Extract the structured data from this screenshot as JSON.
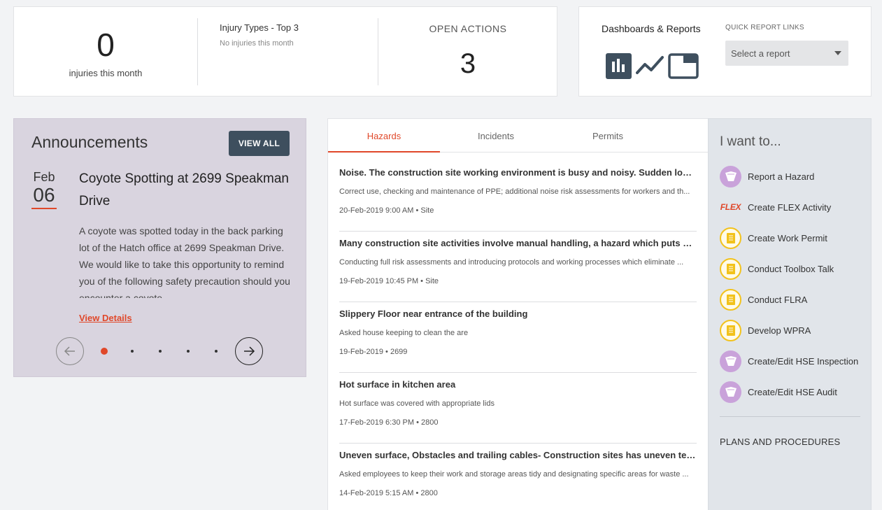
{
  "stats": {
    "injuries_count": "0",
    "injuries_caption": "injuries this month",
    "injury_types_title": "Injury Types - Top 3",
    "injury_types_empty": "No injuries this month",
    "open_actions_title": "OPEN ACTIONS",
    "open_actions_count": "3"
  },
  "dashboards": {
    "title": "Dashboards & Reports",
    "icons": [
      "bar-chart-icon",
      "line-chart-icon",
      "window-icon"
    ],
    "quick_links_label": "QUICK REPORT LINKS",
    "select_placeholder": "Select a report"
  },
  "announcements": {
    "title": "Announcements",
    "view_all_label": "VIEW ALL",
    "month": "Feb",
    "day": "06",
    "headline": "Coyote Spotting at 2699 Speakman Drive",
    "body": "A coyote was spotted today in the back parking lot of the Hatch office at 2699 Speakman Drive. We would like to take this opportunity to remind you of the following safety precaution should you encounter a coyote.",
    "view_details_label": "View Details",
    "total_slides": 5,
    "active_slide": 1
  },
  "feed": {
    "tabs": [
      "Hazards",
      "Incidents",
      "Permits"
    ],
    "active_tab": "Hazards",
    "items": [
      {
        "title": "Noise. The construction site working environment is busy and noisy. Sudden loud v...",
        "desc": "Correct use, checking and maintenance of PPE; additional noise risk assessments for workers and th...",
        "meta": "20-Feb-2019 9:00 AM • Site"
      },
      {
        "title": "Many construction site activities involve manual handling, a hazard which puts wor...",
        "desc": "Conducting full risk assessments and introducing protocols and working processes which eliminate ...",
        "meta": "19-Feb-2019 10:45 PM • Site"
      },
      {
        "title": "Slippery Floor near entrance of the building",
        "desc": "Asked house keeping to clean the are",
        "meta": "19-Feb-2019 • 2699"
      },
      {
        "title": "Hot surface in kitchen area",
        "desc": "Hot surface was covered with appropriate lids",
        "meta": "17-Feb-2019 6:30 PM • 2800"
      },
      {
        "title": "Uneven surface, Obstacles and trailing cables- Construction sites has uneven terrai...",
        "desc": "Asked employees to keep their work and storage areas tidy and designating specific areas for waste ...",
        "meta": "14-Feb-2019 5:15 AM • 2800"
      }
    ]
  },
  "want": {
    "title": "I want to...",
    "items": [
      {
        "label": "Report a Hazard",
        "icon": "hazard-icon"
      },
      {
        "label": "Create FLEX Activity",
        "icon": "flex-logo"
      },
      {
        "label": "Create Work Permit",
        "icon": "document-icon"
      },
      {
        "label": "Conduct Toolbox Talk",
        "icon": "document-icon"
      },
      {
        "label": "Conduct FLRA",
        "icon": "document-icon"
      },
      {
        "label": "Develop WPRA",
        "icon": "document-icon"
      },
      {
        "label": "Create/Edit HSE Inspection",
        "icon": "hazard-icon"
      },
      {
        "label": "Create/Edit HSE Audit",
        "icon": "hazard-icon"
      }
    ],
    "flex_text": "FLEX",
    "plans_label": "PLANS AND PROCEDURES"
  },
  "colors": {
    "accent": "#e0482a",
    "dark_button": "#3e4f5e",
    "announcement_bg": "#d9d4df",
    "panel_bg": "#e1e5ea"
  }
}
